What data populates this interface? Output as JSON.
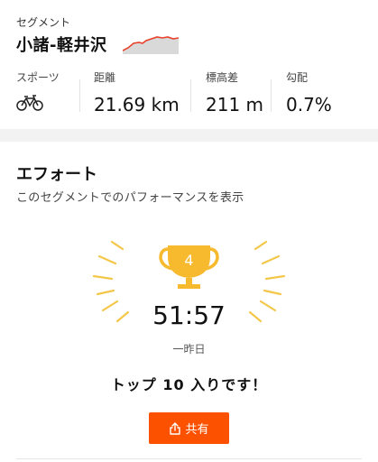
{
  "segment": {
    "label": "セグメント",
    "name": "小諸-軽井沢"
  },
  "stats": [
    {
      "label": "スポーツ",
      "icon": "bicycle-icon"
    },
    {
      "label": "距離",
      "value": "21.69 km"
    },
    {
      "label": "標高差",
      "value": "211 m"
    },
    {
      "label": "勾配",
      "value": "0.7%"
    }
  ],
  "effort": {
    "title": "エフォート",
    "subtitle": "このセグメントでのパフォーマンスを表示",
    "rank": "4",
    "time": "51:57",
    "date": "一昨日",
    "message": "トップ 10 入りです！"
  },
  "share": {
    "label": "共有",
    "icon": "share-icon"
  },
  "colors": {
    "accent": "#fc5200",
    "trophy": "#f7b92e",
    "rays": "#f3c74a",
    "elevation_line": "#e8412c"
  }
}
